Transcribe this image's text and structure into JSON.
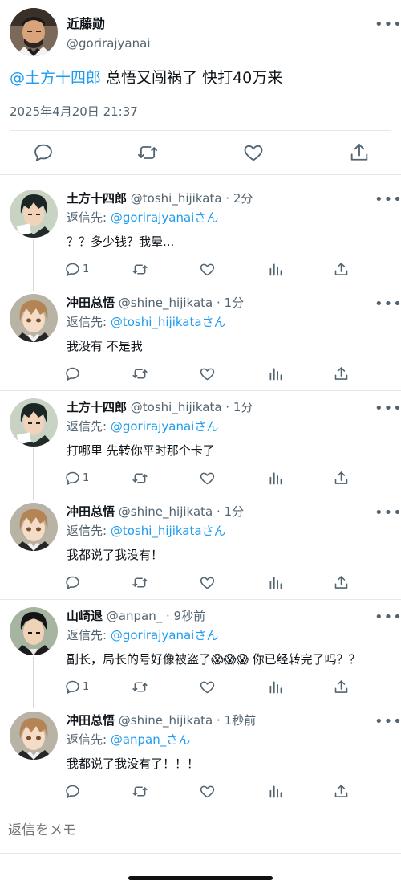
{
  "main_tweet": {
    "display_name": "近藤勋",
    "handle": "@gorirajyanai",
    "mention": "@土方十四郎",
    "text": " 总悟又闯祸了 快打40万来",
    "timestamp": "2025年4月20日 21:37",
    "more_label": "•••"
  },
  "replies": [
    {
      "display_name": "土方十四郎",
      "meta": "@toshi_hijikata · 2分",
      "reply_prefix": "返信先: ",
      "reply_to": "@gorirajyanaiさん",
      "text": "？？多少钱？我晕...",
      "reply_count": "1",
      "avatar": "hijikata"
    },
    {
      "display_name": "冲田总悟",
      "meta": "@shine_hijikata · 1分",
      "reply_prefix": "返信先: ",
      "reply_to": "@toshi_hijikataさん",
      "text": "我没有 不是我",
      "reply_count": "",
      "avatar": "okita"
    },
    {
      "display_name": "土方十四郎",
      "meta": "@toshi_hijikata · 1分",
      "reply_prefix": "返信先: ",
      "reply_to": "@gorirajyanaiさん",
      "text": "打哪里 先转你平时那个卡了",
      "reply_count": "1",
      "avatar": "hijikata"
    },
    {
      "display_name": "冲田总悟",
      "meta": "@shine_hijikata · 1分",
      "reply_prefix": "返信先: ",
      "reply_to": "@toshi_hijikataさん",
      "text": "我都说了我没有！",
      "reply_count": "",
      "avatar": "okita"
    },
    {
      "display_name": "山崎退",
      "meta": "@anpan_ · 9秒前",
      "reply_prefix": "返信先: ",
      "reply_to": "@gorirajyanaiさん",
      "text": "副长，局长的号好像被盗了😱😱😱 你已经转完了吗？？",
      "reply_count": "1",
      "avatar": "yamazaki"
    },
    {
      "display_name": "冲田总悟",
      "meta": "@shine_hijikata · 1秒前",
      "reply_prefix": "返信先: ",
      "reply_to": "@anpan_さん",
      "text": "我都说了我没有了！！！",
      "reply_count": "",
      "avatar": "okita"
    }
  ],
  "compose": {
    "placeholder": "返信をメモ"
  },
  "colors": {
    "accent": "#1d9bf0",
    "secondary_text": "#536471",
    "border": "#e6e9ec"
  },
  "icons": [
    "reply-icon",
    "retweet-icon",
    "like-icon",
    "views-icon",
    "share-icon",
    "more-icon"
  ]
}
